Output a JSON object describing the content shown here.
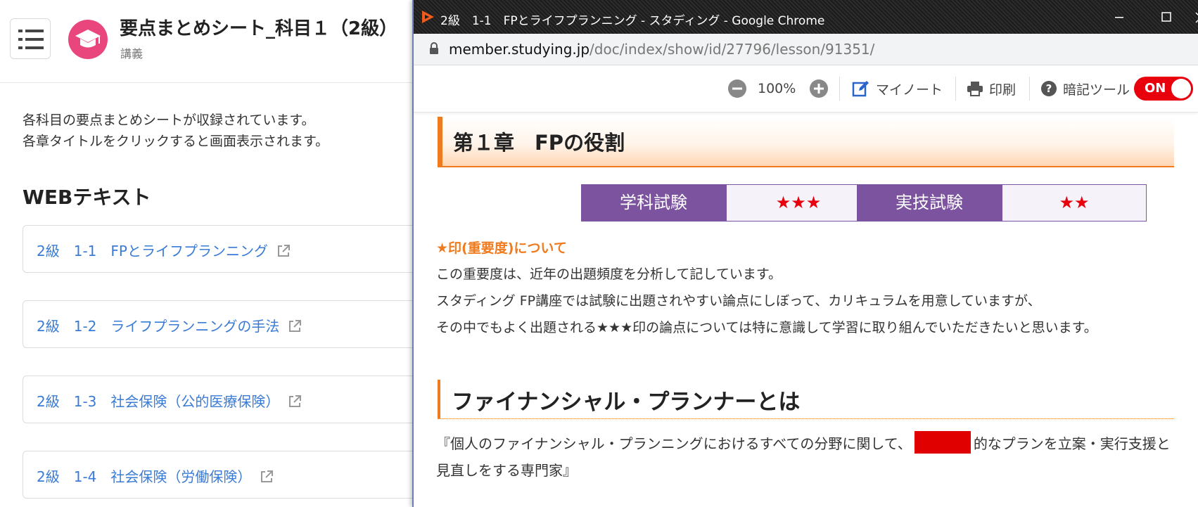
{
  "course": {
    "title": "要点まとめシート_科目１（2級）",
    "subtitle": "講義",
    "description": [
      "各科目の要点まとめシートが収録されています。",
      "各章タイトルをクリックすると画面表示されます。"
    ],
    "section_heading": "WEBテキスト",
    "lessons": [
      {
        "label": "2級　1-1　FPとライフプランニング"
      },
      {
        "label": "2級　1-2　ライフプランニングの手法"
      },
      {
        "label": "2級　1-3　社会保険（公的医療保険）"
      },
      {
        "label": "2級　1-4　社会保険（労働保険）"
      }
    ]
  },
  "popup": {
    "window_title": "2級　1-1　FPとライフプランニング - スタディング - Google Chrome",
    "url_host": "member.studying.jp",
    "url_path": "/doc/index/show/id/27796/lesson/91351/",
    "toolbar": {
      "zoom": "100%",
      "mynote": "マイノート",
      "print": "印刷",
      "memorize": "暗記ツール",
      "toggle": "ON"
    },
    "chapter_title": "第１章　FPの役割",
    "exams": [
      {
        "label": "学科試験",
        "stars": "★★★",
        "importance": 3
      },
      {
        "label": "実技試験",
        "stars": "★★",
        "importance": 2
      }
    ],
    "note_heading": "★印(重要度)について",
    "note_lines": [
      "この重要度は、近年の出題頻度を分析して記しています。",
      "スタディング FP講座では試験に出題されやすい論点にしぼって、カリキュラムを用意していますが、",
      "その中でもよく出題される★★★印の論点については特に意識して学習に取り組んでいただきたいと思います。"
    ],
    "section_title": "ファイナンシャル・プランナーとは",
    "quote_before": "『個人のファイナンシャル・プランニングにおけるすべての分野に関して、",
    "quote_after": "的なプランを立案・実行支援と見直しをする専門家』"
  },
  "colors": {
    "accent_orange": "#f07a1e",
    "exam_purple": "#7b539e",
    "star_red": "#e8000d",
    "course_pink": "#e8467c",
    "link_blue": "#3a7bd5"
  }
}
